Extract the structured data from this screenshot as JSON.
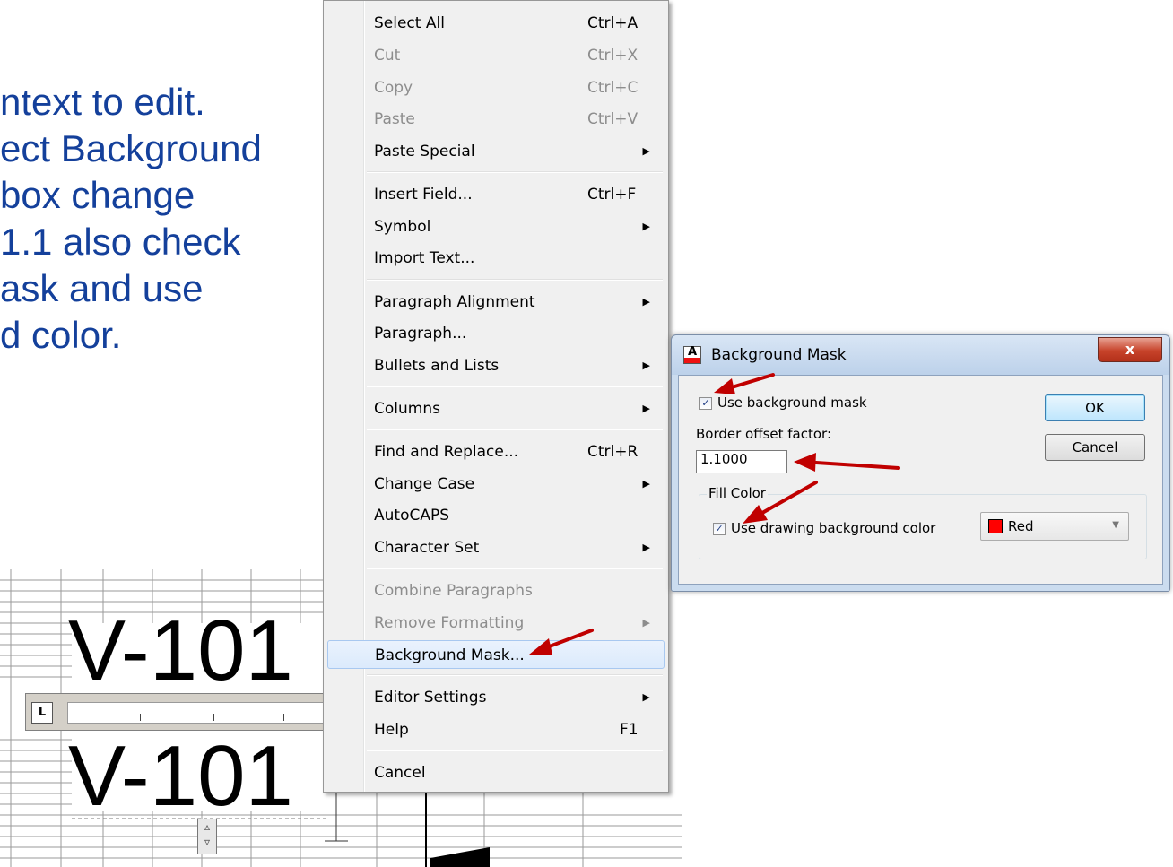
{
  "slide": {
    "lines": [
      "ntext to edit.",
      "ect Background",
      " box change",
      " 1.1 also check",
      "ask and use",
      "d color."
    ]
  },
  "drawing": {
    "label_top": "V-101",
    "label_bottom": "V-101",
    "ruler_tab": "L"
  },
  "context_menu": {
    "items": [
      {
        "label": "Select All",
        "shortcut": "Ctrl+A"
      },
      {
        "label": "Cut",
        "shortcut": "Ctrl+X"
      },
      {
        "label": "Copy",
        "shortcut": "Ctrl+C"
      },
      {
        "label": "Paste",
        "shortcut": "Ctrl+V"
      },
      {
        "label": "Paste Special"
      },
      {
        "label": "Insert Field...",
        "shortcut": "Ctrl+F"
      },
      {
        "label": "Symbol"
      },
      {
        "label": "Import Text..."
      },
      {
        "label": "Paragraph Alignment"
      },
      {
        "label": "Paragraph..."
      },
      {
        "label": "Bullets and Lists"
      },
      {
        "label": "Columns"
      },
      {
        "label": "Find and Replace...",
        "shortcut": "Ctrl+R"
      },
      {
        "label": "Change Case"
      },
      {
        "label": "AutoCAPS"
      },
      {
        "label": "Character Set"
      },
      {
        "label": "Combine Paragraphs"
      },
      {
        "label": "Remove Formatting"
      },
      {
        "label": "Background Mask..."
      },
      {
        "label": "Editor Settings"
      },
      {
        "label": "Help",
        "shortcut": "F1"
      },
      {
        "label": "Cancel"
      }
    ]
  },
  "dialog": {
    "title": "Background Mask",
    "close_label": "x",
    "use_mask_label": "Use background mask",
    "use_mask_checked": true,
    "border_offset_label": "Border offset factor:",
    "border_offset_value": "1.1000",
    "fill_color_group": "Fill Color",
    "use_bg_color_label": "Use drawing background color",
    "use_bg_color_checked": true,
    "color_value": "Red",
    "color_hex": "#ff0000",
    "ok_label": "OK",
    "cancel_label": "Cancel"
  },
  "icons": {
    "submenu": "submenu-arrow-icon",
    "dialog": "text-editor-icon",
    "annotation": "red-arrow-icon"
  },
  "colors": {
    "slide_text": "#14409b",
    "annotation_arrow": "#c00000"
  }
}
